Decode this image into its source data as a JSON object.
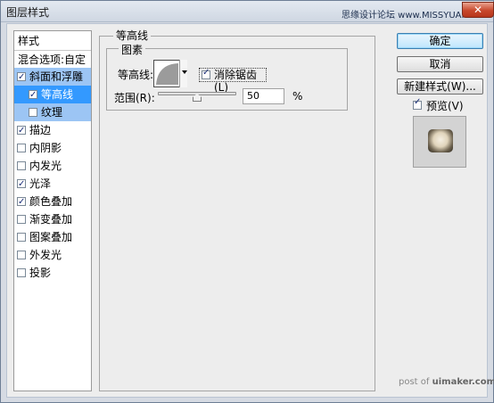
{
  "window": {
    "title": "图层样式",
    "watermark_top": "思缘设计论坛 www.MISSYUAN.COM",
    "close_glyph": "✕"
  },
  "styles_list": {
    "header": "样式",
    "blend_options": "混合选项:自定",
    "items": [
      {
        "label": "斜面和浮雕",
        "checked": true,
        "selected": false
      },
      {
        "label": "等高线",
        "checked": true,
        "selected": true
      },
      {
        "label": "纹理",
        "checked": false,
        "selected": false
      },
      {
        "label": "描边",
        "checked": true,
        "selected": false
      },
      {
        "label": "内阴影",
        "checked": false,
        "selected": false
      },
      {
        "label": "内发光",
        "checked": false,
        "selected": false
      },
      {
        "label": "光泽",
        "checked": true,
        "selected": false
      },
      {
        "label": "颜色叠加",
        "checked": true,
        "selected": false
      },
      {
        "label": "渐变叠加",
        "checked": false,
        "selected": false
      },
      {
        "label": "图案叠加",
        "checked": false,
        "selected": false
      },
      {
        "label": "外发光",
        "checked": false,
        "selected": false
      },
      {
        "label": "投影",
        "checked": false,
        "selected": false
      }
    ]
  },
  "contour_panel": {
    "group_title": "等高线",
    "subgroup_title": "图素",
    "contour_label": "等高线:",
    "antialias_label": "消除锯齿(L)",
    "antialias_checked": true,
    "range_label": "范围(R):",
    "range_value": "50",
    "range_unit": "%",
    "range_fraction": 0.5
  },
  "buttons": {
    "ok": "确定",
    "cancel": "取消",
    "new_style": "新建样式(W)...",
    "preview_label": "预览(V)",
    "preview_checked": true
  },
  "footer": {
    "watermark_prefix": "post of",
    "watermark_brand": "uimaker.com"
  },
  "colors": {
    "selection": "#3399ff",
    "selection_child": "#9cc5f4",
    "title_bar": "#dbe2eb",
    "close_button": "#c8482c"
  }
}
